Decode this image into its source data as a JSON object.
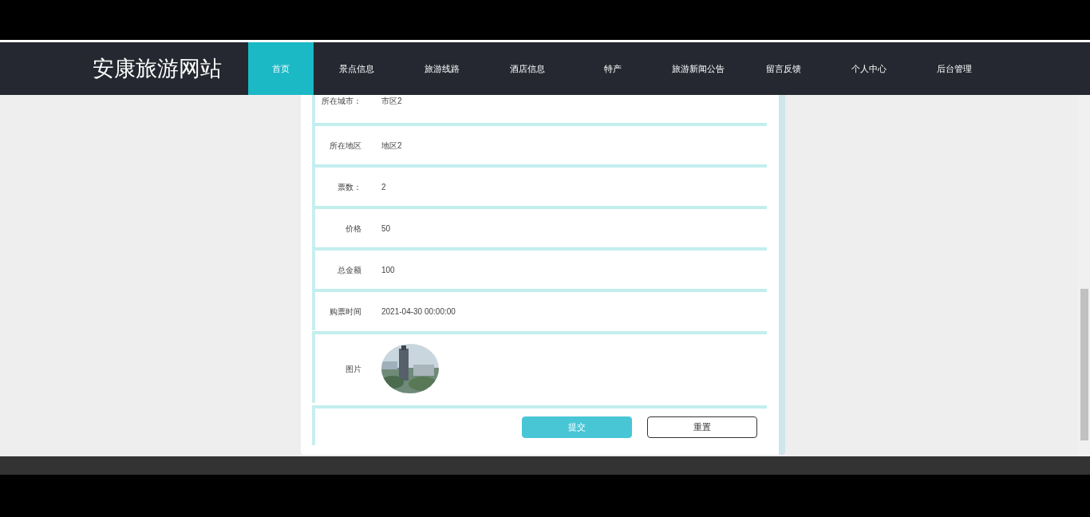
{
  "site_title": "安康旅游网站",
  "nav": [
    {
      "label": "首页",
      "selected": true
    },
    {
      "label": "景点信息",
      "selected": false
    },
    {
      "label": "旅游线路",
      "selected": false
    },
    {
      "label": "酒店信息",
      "selected": false
    },
    {
      "label": "特产",
      "selected": false
    },
    {
      "label": "旅游新闻公告",
      "selected": false
    },
    {
      "label": "留言反馈",
      "selected": false
    },
    {
      "label": "个人中心",
      "selected": false
    },
    {
      "label": "后台管理",
      "selected": false
    }
  ],
  "fields": [
    {
      "kind": "text",
      "label": "所在城市：",
      "value": "市区2"
    },
    {
      "kind": "text",
      "label": "所在地区",
      "value": "地区2"
    },
    {
      "kind": "text",
      "label": "票数：",
      "value": "2"
    },
    {
      "kind": "text",
      "label": "价格",
      "value": "50"
    },
    {
      "kind": "text",
      "label": "总金额",
      "value": "100"
    },
    {
      "kind": "text",
      "label": "购票时间",
      "value": "2021-04-30 00:00:00"
    },
    {
      "kind": "picture",
      "label": "图片"
    }
  ],
  "buttons": [
    {
      "kind": "primary",
      "label": "提交"
    },
    {
      "kind": "outline",
      "label": "重置"
    }
  ]
}
